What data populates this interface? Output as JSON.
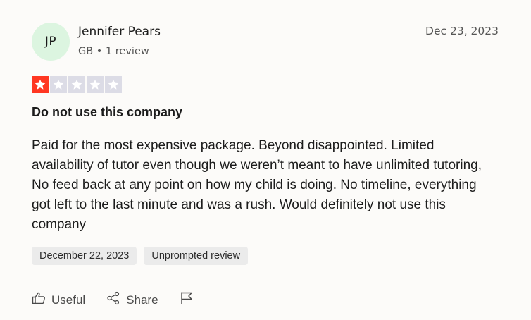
{
  "reviewer": {
    "initials": "JP",
    "name": "Jennifer Pears",
    "meta": "GB • 1 review"
  },
  "review": {
    "date": "Dec 23, 2023",
    "rating": 1,
    "rating_max": 5,
    "title": "Do not use this company",
    "body": "Paid for the most expensive package. Beyond disappointed. Limited availability of tutor even though we weren’t meant to have unlimited tutoring, No feed back at any point on how my child is doing. No timeline, everything got left to the last minute and was a rush. Would definitely not use this company",
    "tags": [
      "December 22, 2023",
      "Unprompted review"
    ]
  },
  "actions": {
    "useful_label": "Useful",
    "share_label": "Share"
  },
  "colors": {
    "star_filled": "#ff3722",
    "star_empty": "#dcdce6",
    "avatar_bg": "#dcf5e0"
  },
  "icons": [
    "thumbs-up-icon",
    "share-icon",
    "flag-icon",
    "star-icon"
  ]
}
